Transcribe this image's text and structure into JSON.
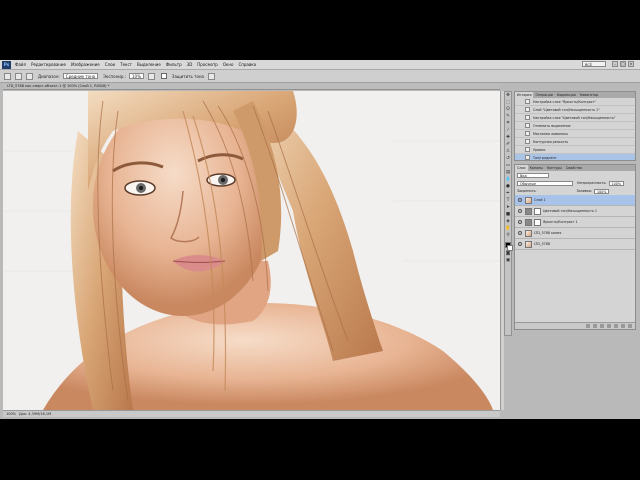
{
  "app": {
    "logo": "Ps",
    "menu": [
      "Файл",
      "Редактирование",
      "Изображение",
      "Слои",
      "Текст",
      "Выделение",
      "Фильтр",
      "3D",
      "Просмотр",
      "Окно",
      "Справка"
    ],
    "workspace": "ВСЁ",
    "window_controls": [
      "–",
      "□",
      "×"
    ]
  },
  "options_bar": {
    "tool_icon": "sharpen-tool-icon",
    "mode_label": "Диапазон:",
    "mode_value": "Средние тона",
    "exposure_label": "Экспонир.:",
    "exposure_value": "10%",
    "protect_label": "Защитить тона"
  },
  "document": {
    "tab_title": "LTD_5788 как смарт-объект-1 @ 100% (Слой 1, RGB/8) *",
    "zoom": "100%",
    "doc_size": "Док: 4,39M/16,1M"
  },
  "history_panel": {
    "tabs": [
      "История",
      "Операции",
      "Коррекция",
      "Навигатор"
    ],
    "items": [
      {
        "label": "Настройка слоя \"Яркость/Контраст\"",
        "selected": false
      },
      {
        "label": "Слой \"Цветовой тон/Насыщенность 1\"",
        "selected": false
      },
      {
        "label": "Настройка слоя \"Цветовой тон/Насыщенность\"",
        "selected": false
      },
      {
        "label": "Отменить выделение",
        "selected": false
      },
      {
        "label": "Масляная живопись",
        "selected": false
      },
      {
        "label": "Контурная резкость",
        "selected": false
      },
      {
        "label": "Уровни",
        "selected": false
      },
      {
        "label": "Тон/градиент",
        "selected": true
      }
    ]
  },
  "layers_panel": {
    "tabs": [
      "Слои",
      "Каналы",
      "Контуры",
      "Свойства"
    ],
    "filter_label": "Вид",
    "blend_mode": "Обычные",
    "opacity_label": "Непрозрачность:",
    "opacity_value": "100%",
    "lock_label": "Закрепить:",
    "fill_label": "Заливка:",
    "fill_value": "100%",
    "layers": [
      {
        "name": "Слой 1",
        "thumb": "photo",
        "selected": true
      },
      {
        "name": "Цветовой тон/Насыщенность 1",
        "thumb": "adj",
        "selected": false
      },
      {
        "name": "Яркость/Контраст 1",
        "thumb": "adj",
        "selected": false
      },
      {
        "name": "LTD_5788 копия",
        "thumb": "photo",
        "selected": false
      },
      {
        "name": "LTD_5788",
        "thumb": "photo",
        "selected": false
      }
    ]
  },
  "colors": {
    "selection": "#a8c3e9",
    "panel_bg": "#d4d4d4",
    "canvas_bg": "#f1f0ee"
  }
}
